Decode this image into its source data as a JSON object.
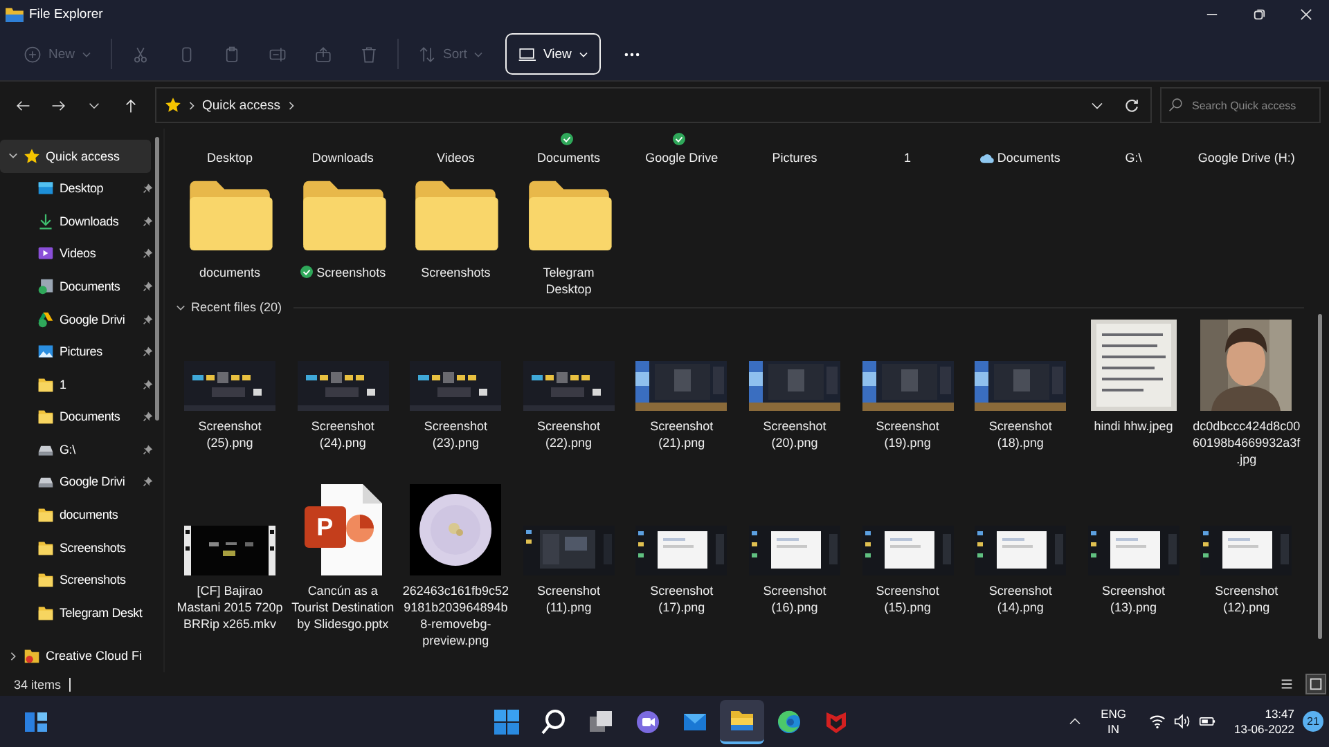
{
  "window": {
    "title": "File Explorer"
  },
  "toolbar": {
    "buttons": [
      {
        "kind": "new",
        "label": "New",
        "disabled": true,
        "selected": false
      },
      {
        "kind": "separator"
      },
      {
        "kind": "cut",
        "disabled": true,
        "selected": false
      },
      {
        "kind": "copy",
        "disabled": true,
        "selected": false
      },
      {
        "kind": "paste",
        "disabled": true,
        "selected": false
      },
      {
        "kind": "rename",
        "disabled": true,
        "selected": false
      },
      {
        "kind": "share",
        "disabled": true,
        "selected": false
      },
      {
        "kind": "delete",
        "disabled": true,
        "selected": false
      },
      {
        "kind": "separator"
      },
      {
        "kind": "sort",
        "label": "Sort",
        "disabled": true,
        "selected": false
      },
      {
        "kind": "view",
        "label": "View",
        "disabled": false,
        "selected": true
      },
      {
        "kind": "more",
        "disabled": false,
        "selected": false
      }
    ]
  },
  "address": {
    "path": [
      "Quick access"
    ],
    "search": {
      "placeholder": "Search Quick access"
    }
  },
  "sidebar": {
    "items": [
      {
        "label": "Quick access",
        "kind": "star",
        "expanded": true,
        "selected": true,
        "children": [
          {
            "label": "Desktop",
            "kind": "desktop",
            "pinned": true,
            "selected": false
          },
          {
            "label": "Downloads",
            "kind": "downloads",
            "pinned": true,
            "selected": false
          },
          {
            "label": "Videos",
            "kind": "videos",
            "pinned": true,
            "selected": false
          },
          {
            "label": "Documents",
            "kind": "documents-sync",
            "pinned": true,
            "selected": false
          },
          {
            "label": "Google Drivi",
            "kind": "drive-sync",
            "pinned": true,
            "selected": false
          },
          {
            "label": "Pictures",
            "kind": "pictures",
            "pinned": true,
            "selected": false
          },
          {
            "label": "1",
            "kind": "folder",
            "pinned": true,
            "selected": false
          },
          {
            "label": "Documents",
            "kind": "folder",
            "pinned": true,
            "selected": false
          },
          {
            "label": "G:\\",
            "kind": "drive",
            "pinned": true,
            "selected": false
          },
          {
            "label": "Google Drivi",
            "kind": "drive",
            "pinned": true,
            "selected": false
          },
          {
            "label": "documents",
            "kind": "folder",
            "pinned": false,
            "selected": false
          },
          {
            "label": "Screenshots",
            "kind": "folder",
            "pinned": false,
            "selected": false
          },
          {
            "label": "Screenshots",
            "kind": "folder",
            "pinned": false,
            "selected": false
          },
          {
            "label": "Telegram Deskt",
            "kind": "folder",
            "pinned": false,
            "selected": false
          }
        ]
      },
      {
        "label": "Creative Cloud Fi",
        "kind": "cc",
        "expanded": false,
        "selected": false
      }
    ]
  },
  "pinned": [
    {
      "label": "Desktop",
      "kind": "plain"
    },
    {
      "label": "Downloads",
      "kind": "plain"
    },
    {
      "label": "Videos",
      "kind": "plain"
    },
    {
      "label": "Documents",
      "kind": "synced"
    },
    {
      "label": "Google Drive",
      "kind": "synced"
    },
    {
      "label": "Pictures",
      "kind": "plain"
    },
    {
      "label": "1",
      "kind": "plain"
    },
    {
      "label": "Documents",
      "kind": "cloud"
    },
    {
      "label": "G:\\",
      "kind": "plain"
    },
    {
      "label": "Google Drive (H:)",
      "kind": "plain"
    }
  ],
  "folders": [
    {
      "label": "documents",
      "kind": "plain"
    },
    {
      "label": "Screenshots",
      "kind": "synced"
    },
    {
      "label": "Screenshots",
      "kind": "plain"
    },
    {
      "label": "Telegram Desktop",
      "kind": "plain"
    }
  ],
  "recent": {
    "heading": "Recent files (20)",
    "expanded": true,
    "files": [
      {
        "name": "Screenshot (25).png",
        "kind": "dark-screenshot"
      },
      {
        "name": "Screenshot (24).png",
        "kind": "dark-screenshot"
      },
      {
        "name": "Screenshot (23).png",
        "kind": "dark-screenshot"
      },
      {
        "name": "Screenshot (22).png",
        "kind": "dark-screenshot"
      },
      {
        "name": "Screenshot (21).png",
        "kind": "blue-screenshot"
      },
      {
        "name": "Screenshot (20).png",
        "kind": "blue-screenshot"
      },
      {
        "name": "Screenshot (19).png",
        "kind": "blue-screenshot"
      },
      {
        "name": "Screenshot (18).png",
        "kind": "blue-screenshot"
      },
      {
        "name": "hindi hhw.jpeg",
        "kind": "document-photo"
      },
      {
        "name": "dc0dbccc424d8c0060198b4669932a3f.jpg",
        "kind": "portrait"
      },
      {
        "name": "[CF] Bajirao Mastani 2015 720p BRRip x265.mkv",
        "kind": "video"
      },
      {
        "name": "Cancún as a Tourist Destination by Slidesgo.pptx",
        "kind": "pptx",
        "badge": "P"
      },
      {
        "name": "262463c161fb9c529181b203964894b8-removebg-preview.png",
        "kind": "disc"
      },
      {
        "name": "Screenshot (11).png",
        "kind": "window-screenshot"
      },
      {
        "name": "Screenshot (17).png",
        "kind": "white-screenshot"
      },
      {
        "name": "Screenshot (16).png",
        "kind": "white-screenshot"
      },
      {
        "name": "Screenshot (15).png",
        "kind": "white-screenshot"
      },
      {
        "name": "Screenshot (14).png",
        "kind": "white-screenshot"
      },
      {
        "name": "Screenshot (13).png",
        "kind": "white-screenshot"
      },
      {
        "name": "Screenshot (12).png",
        "kind": "white-screenshot"
      }
    ]
  },
  "status_bar": {
    "count": "34 items",
    "views": [
      {
        "kind": "details",
        "selected": false
      },
      {
        "kind": "tiles",
        "selected": true
      }
    ]
  },
  "taskbar": {
    "apps": [
      {
        "kind": "widgets",
        "active": false
      },
      {
        "kind": "start",
        "active": false
      },
      {
        "kind": "search",
        "active": false
      },
      {
        "kind": "task-view",
        "active": false
      },
      {
        "kind": "chat",
        "active": false
      },
      {
        "kind": "mail",
        "active": false
      },
      {
        "kind": "explorer",
        "active": true
      },
      {
        "kind": "edge",
        "active": false
      },
      {
        "kind": "mcafee",
        "active": false
      }
    ],
    "language": [
      "ENG",
      "IN"
    ],
    "time": "13:47",
    "date": "13-06-2022",
    "notifications": "21"
  }
}
